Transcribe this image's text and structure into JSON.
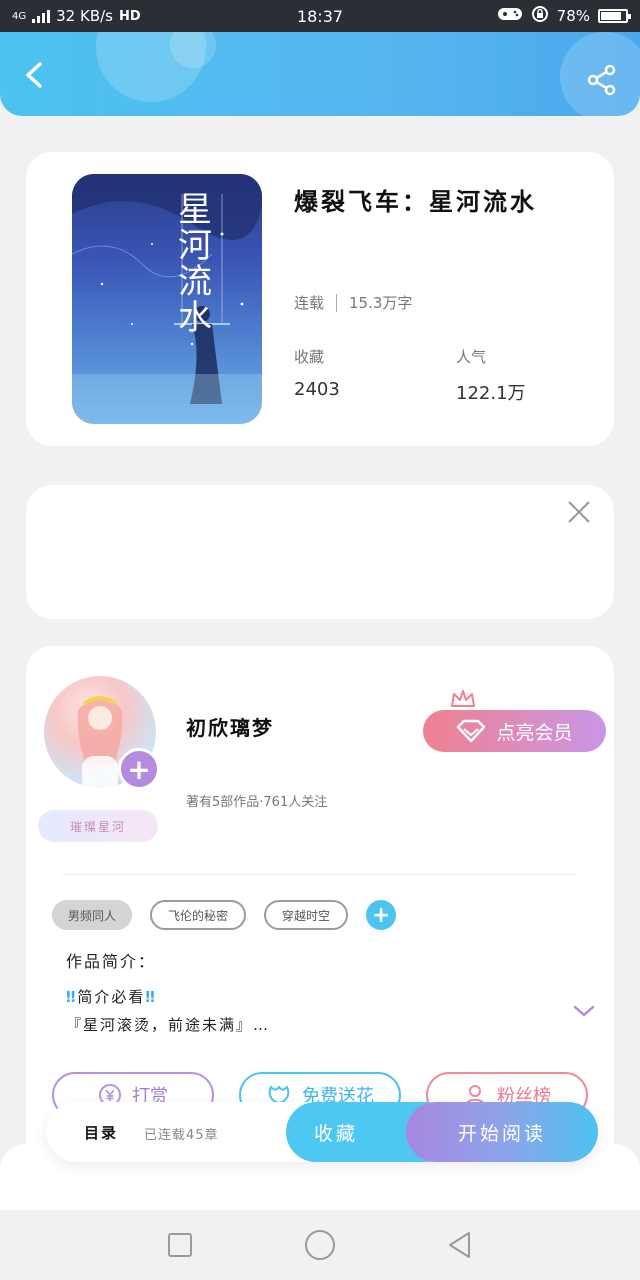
{
  "status_bar": {
    "network": "4G",
    "speed": "32 KB/s",
    "hd": "HD",
    "time": "18:37",
    "battery": "78%",
    "battery_level": 0.78
  },
  "header": {
    "back_icon": "chevron-left-icon",
    "share_icon": "share-icon",
    "color": "#4cc3f0"
  },
  "book": {
    "cover_title": "星河流水",
    "title": "爆裂飞车：星河流水",
    "status": "连载",
    "word_count": "15.3万字",
    "favorites_label": "收藏",
    "favorites_value": "2403",
    "popularity_label": "人气",
    "popularity_value": "122.1万"
  },
  "ad": {
    "close_icon": "close-icon"
  },
  "author": {
    "tag": "璀璨星河",
    "name": "初欣璃梦",
    "meta": "著有5部作品·761人关注",
    "vip_label": "点亮会员",
    "plus": "+"
  },
  "tags": [
    "男频同人",
    "飞伦的秘密",
    "穿越时空"
  ],
  "tag_add": "+",
  "intro": {
    "title": "作品简介：",
    "line1_prefix": "‼",
    "line1_text": "简介必看",
    "line1_suffix": "‼",
    "line2": "『星河滚烫，前途未满』…"
  },
  "actions": {
    "reward": "打赏",
    "flower": "免费送花",
    "fans": "粉丝榜"
  },
  "bottom_bar": {
    "toc": "目录",
    "toc_status": "已连载45章",
    "collect": "收藏",
    "read": "开始阅读"
  },
  "nav": {
    "recent_icon": "square-icon",
    "home_icon": "circle-icon",
    "back_icon": "triangle-back-icon"
  }
}
